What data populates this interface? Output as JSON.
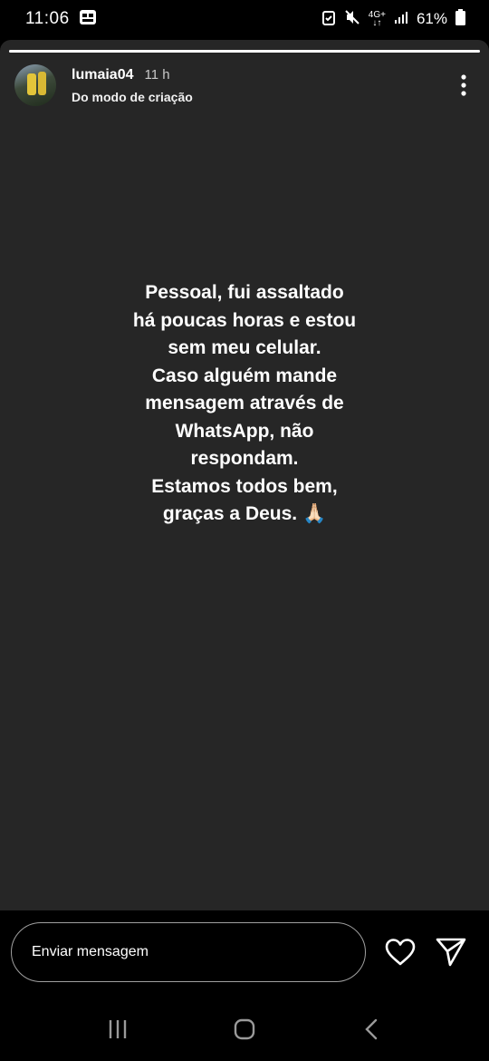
{
  "status_bar": {
    "time": "11:06",
    "network": "4G+",
    "battery": "61%"
  },
  "story": {
    "username": "lumaia04",
    "time_ago": "11 h",
    "subtitle": "Do modo de criação",
    "text": "Pessoal, fui assaltado\nhá poucas horas e estou\nsem meu celular.\nCaso alguém mande\nmensagem através de\nWhatsApp, não\nrespondam.\nEstamos todos bem,\ngraças a Deus. 🙏🏻"
  },
  "reply_bar": {
    "placeholder": "Enviar mensagem"
  },
  "icons": {
    "more": "more-vertical-icon",
    "like": "heart-icon",
    "share": "send-icon",
    "nav_recents": "recents-icon",
    "nav_home": "home-icon",
    "nav_back": "back-icon"
  },
  "colors": {
    "background": "#000000",
    "story_background": "#262626",
    "text": "#ffffff"
  }
}
